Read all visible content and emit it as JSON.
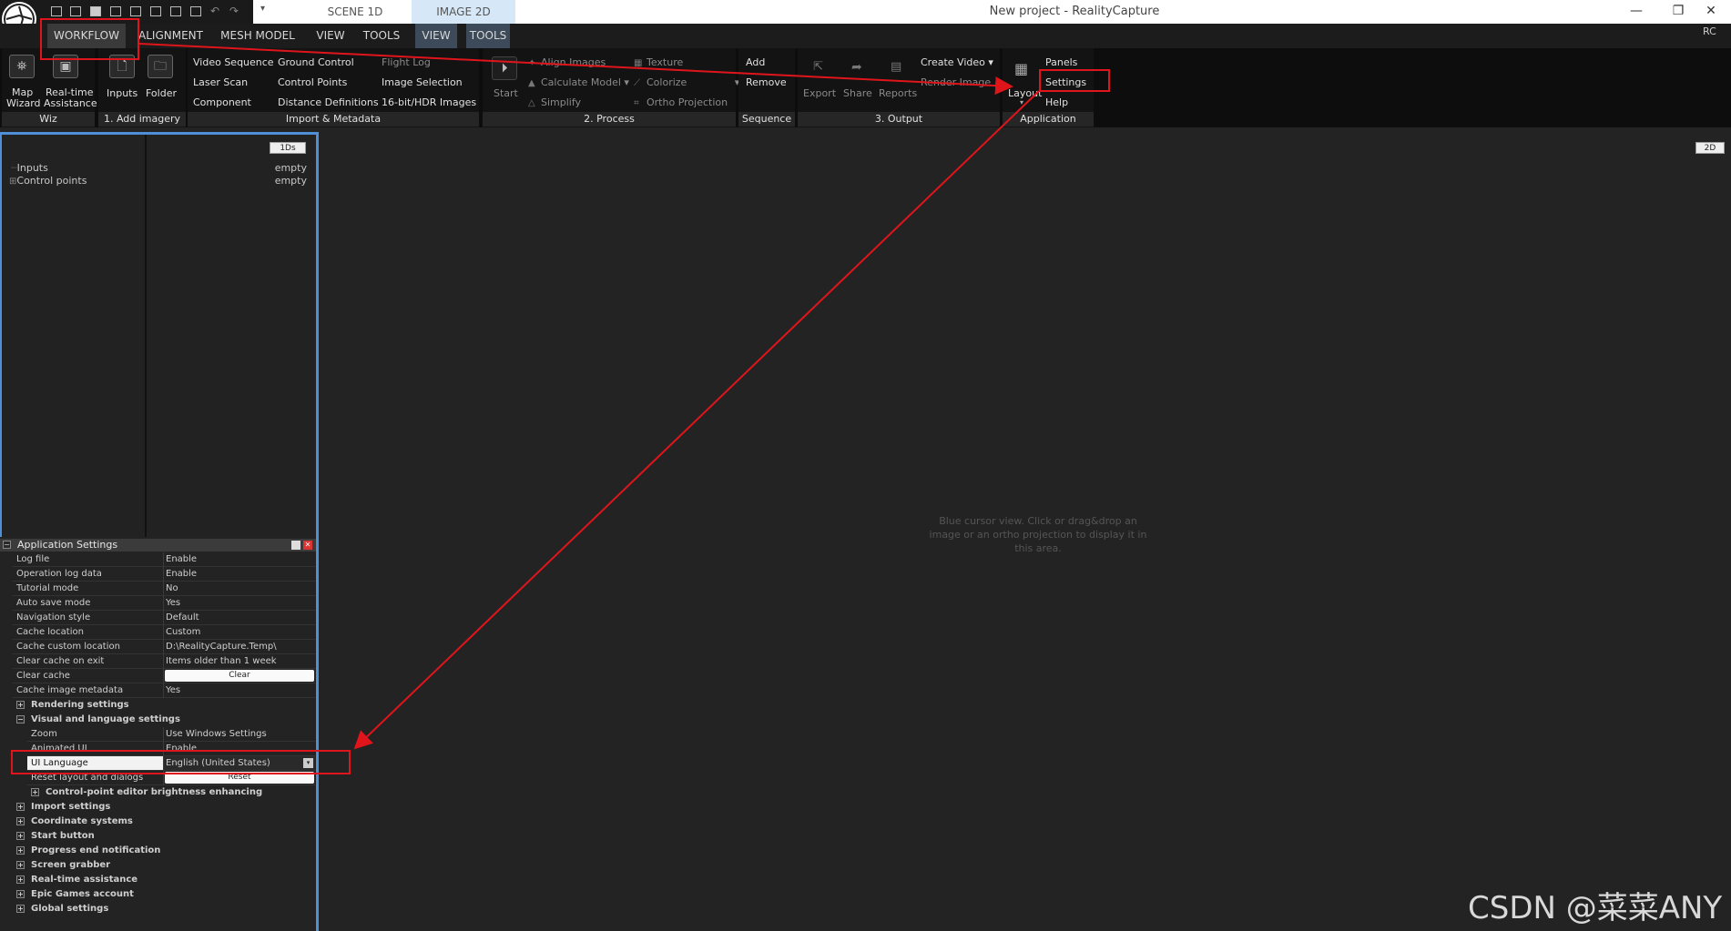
{
  "window": {
    "title": "New project - RealityCapture",
    "scene_tab": "SCENE 1D",
    "image_tab": "IMAGE 2D",
    "rc_label": "RC",
    "minimize": "—",
    "restore": "❐",
    "close": "✕"
  },
  "menu": {
    "workflow": "WORKFLOW",
    "alignment": "ALIGNMENT",
    "mesh_model": "MESH MODEL",
    "view": "VIEW",
    "tools": "TOOLS",
    "view2": "VIEW",
    "tools2": "TOOLS"
  },
  "ribbon": {
    "wiz": {
      "map_wizard_1": "Map",
      "map_wizard_2": "Wizard",
      "realtime_1": "Real-time",
      "realtime_2": "Assistance",
      "caption": "Wiz"
    },
    "add_imagery": {
      "inputs": "Inputs",
      "folder": "Folder",
      "caption": "1. Add imagery"
    },
    "import": {
      "col1": [
        "Video Sequence",
        "Laser Scan",
        "Component"
      ],
      "col2": [
        "Ground Control",
        "Control Points",
        "Distance Definitions"
      ],
      "col3": [
        "Flight Log",
        "Image Selection",
        "16-bit/HDR Images"
      ],
      "caption": "Import & Metadata"
    },
    "process": {
      "start": "Start",
      "col1": [
        "Align Images",
        "Calculate Model",
        "Simplify"
      ],
      "col2": [
        "Texture",
        "Colorize",
        "Ortho Projection"
      ],
      "caption": "2. Process"
    },
    "sequence": {
      "add": "Add",
      "remove": "Remove",
      "caption": "Sequence"
    },
    "output": {
      "export": "Export",
      "share": "Share",
      "reports": "Reports",
      "create_video": "Create Video",
      "render_image": "Render Image",
      "caption": "3. Output"
    },
    "application": {
      "layout": "Layout",
      "panels": "Panels",
      "settings": "Settings",
      "help": "Help",
      "caption": "Application"
    }
  },
  "tree": {
    "inputs": "Inputs",
    "control_points": "Control points",
    "badge": "1Ds",
    "val1": "empty",
    "val2": "empty"
  },
  "viewport": {
    "badge": "2D",
    "hint": "Blue cursor view. Click or drag&drop an image or an ortho projection to display it in this area."
  },
  "settings": {
    "title": "Application Settings",
    "rows": [
      {
        "k": "Log file",
        "v": "Enable"
      },
      {
        "k": "Operation log data",
        "v": "Enable"
      },
      {
        "k": "Tutorial mode",
        "v": "No"
      },
      {
        "k": "Auto save mode",
        "v": "Yes"
      },
      {
        "k": "Navigation style",
        "v": "Default"
      },
      {
        "k": "Cache location",
        "v": "Custom"
      },
      {
        "k": "Cache custom location",
        "v": "D:\\RealityCapture.Temp\\"
      },
      {
        "k": "Clear cache on exit",
        "v": "Items older than 1 week"
      },
      {
        "k": "Clear cache",
        "v": "Clear"
      },
      {
        "k": "Cache image metadata",
        "v": "Yes"
      }
    ],
    "rendering": "Rendering settings",
    "visual": "Visual and language settings",
    "visual_rows": [
      {
        "k": "Zoom",
        "v": "Use Windows Settings"
      },
      {
        "k": "Animated UI",
        "v": "Enable"
      },
      {
        "k": "UI Language",
        "v": "English (United States)"
      },
      {
        "k": "Reset layout and dialogs",
        "v": "Reset"
      }
    ],
    "cp_brightness": "Control-point editor brightness enhancing",
    "groups": [
      "Import settings",
      "Coordinate systems",
      "Start button",
      "Progress end notification",
      "Screen grabber",
      "Real-time assistance",
      "Epic Games account",
      "Global settings"
    ]
  },
  "watermark": "CSDN @菜菜ANY",
  "colors": {
    "annotation_red": "#e0151b",
    "panel_blue": "#4f8fd8"
  }
}
